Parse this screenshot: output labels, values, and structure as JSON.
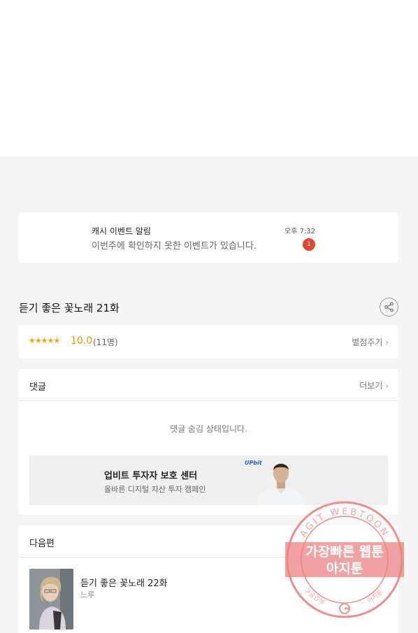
{
  "notification": {
    "title": "캐시 이벤트 알림",
    "message": "이번주에 확인하지 못한 이벤트가 있습니다.",
    "time": "오후 7:32",
    "badge": "1"
  },
  "episode": {
    "title": "듣기 좋은 꽃노래 21화"
  },
  "rating": {
    "stars": "★★★★★",
    "score": "10.0",
    "count": "(11명)",
    "rate_button": "별점주기"
  },
  "comments": {
    "header": "댓글",
    "more": "더보기",
    "hidden_message": "댓글 숨김 상태입니다."
  },
  "ad": {
    "logo": "UPbit",
    "title": "업비트 투자자 보호 센터",
    "subtitle": "올바른 디지털 자산 투자 캠페인"
  },
  "next_episode": {
    "header": "다음편",
    "title": "듣기 좋은 꽃노래 22화",
    "author": "느루"
  },
  "watermark": {
    "ring_text": "AGIT WEBTOON",
    "line1": "가장빠른 웹툰",
    "line2": "아지툰",
    "bottom_left": "구글검색",
    "bottom_right": "아지툰"
  },
  "colors": {
    "accent_star": "#f2a20a",
    "badge_red": "#e0482d",
    "stamp_red": "#e87878"
  }
}
